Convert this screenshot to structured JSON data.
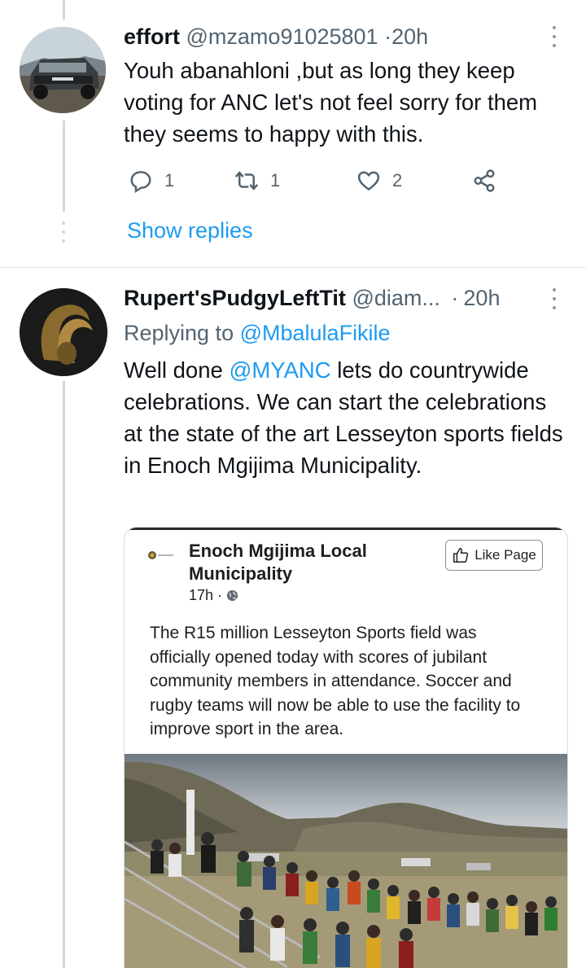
{
  "tweet1": {
    "name": "effort",
    "handle": "@mzamo91025801",
    "separator": "·",
    "time": "20h",
    "text": "Youh abanahloni ,but as long they keep voting for ANC let's not feel sorry for them they seems to happy with this.",
    "replies": "1",
    "retweets": "1",
    "likes": "2",
    "show_replies": "Show replies"
  },
  "tweet2": {
    "name": "Rupert'sPudgyLeftTit",
    "handle": "@diam...",
    "separator": "·",
    "time": "20h",
    "replying_prefix": "Replying to",
    "replying_to": "@MbalulaFikile",
    "text_before_mention": "Well done ",
    "mention": "@MYANC",
    "text_after_mention": " lets do countrywide celebrations. We can start the celebrations at the state of the art Lesseyton sports fields in Enoch Mgijima Municipality."
  },
  "embed": {
    "page_name": "Enoch Mgijima Local Municipality",
    "time": "17h",
    "meta_separator": "·",
    "like_button": "Like Page",
    "post_text": "The R15 million Lesseyton Sports field was officially opened today with scores of jubilant community members in attendance. Soccer and rugby teams will now be able to use the facility to improve sport in the area."
  },
  "colors": {
    "link_blue": "#1d9bf0",
    "secondary_text": "#536471",
    "primary_text": "#0f1419"
  }
}
